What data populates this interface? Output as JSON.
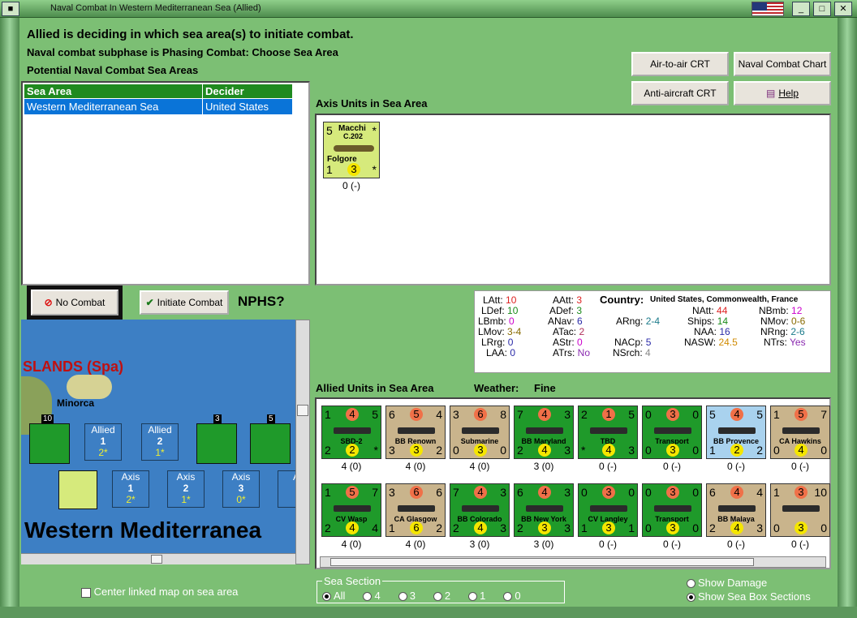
{
  "window": {
    "title": "Naval Combat In Western Mediterranean Sea (Allied)"
  },
  "status": {
    "line1": "Allied is deciding in which sea area(s) to initiate combat.",
    "line2": "Naval combat subphase is Phasing Combat: Choose Sea Area",
    "line3": "Potential Naval Combat Sea Areas"
  },
  "sea_table": {
    "headers": [
      "Sea Area",
      "Decider"
    ],
    "rows": [
      [
        "Western Mediterranean Sea",
        "United States"
      ]
    ]
  },
  "buttons": {
    "air_to_air": "Air-to-air CRT",
    "naval_chart": "Naval Combat Chart",
    "anti_aircraft": "Anti-aircraft CRT",
    "help": "Help",
    "no_combat": "No Combat",
    "initiate": "Initiate Combat"
  },
  "nphs": "NPHS?",
  "axis_units": {
    "label": "Axis Units in Sea Area",
    "counter": {
      "name_top": "Macchi",
      "name_mid": "C.202",
      "name_bottom": "Folgore",
      "tl": "5",
      "tr": "*",
      "bl": "1",
      "bc": "3",
      "br": "*",
      "under": "0 (-)"
    }
  },
  "stats": {
    "LAtt": "10",
    "LDef": "10",
    "LBmb": "0",
    "LMov": "3-4",
    "LRrg": "0",
    "LAA": "0",
    "AAtt": "3",
    "ADef": "3",
    "ANav": "6",
    "ATac": "2",
    "AStr": "0",
    "ATrs": "No",
    "country_label": "Country:",
    "country": "United States, Commonwealth, France",
    "ARng": "2-4",
    "NACp": "5",
    "NSrch": "4",
    "NAtt": "44",
    "Ships": "14",
    "NAA": "16",
    "NASW": "24.5",
    "NBmb": "12",
    "NMov": "0-6",
    "NRng": "2-6",
    "NTrs": "Yes"
  },
  "allied_units": {
    "label": "Allied Units in Sea Area",
    "weather_label": "Weather:",
    "weather": "Fine",
    "row1": [
      {
        "name": "SBD-2",
        "tl": "1",
        "tc": "4",
        "tr": "5",
        "bl": "2",
        "bc": "2",
        "br": "*",
        "under": "4 (0)",
        "color": "#1f9a2a"
      },
      {
        "name": "BB Renown",
        "tl": "6",
        "tc": "5",
        "tr": "4",
        "bl": "3",
        "bc": "3",
        "br": "2",
        "under": "4 (0)",
        "color": "#c9b48c"
      },
      {
        "name": "Submarine",
        "tl": "3",
        "tc": "6",
        "tr": "8",
        "bl": "0",
        "bc": "3",
        "br": "0",
        "under": "4 (0)",
        "color": "#c9b48c"
      },
      {
        "name": "BB Maryland",
        "tl": "7",
        "tc": "4",
        "tr": "3",
        "bl": "2",
        "bc": "4",
        "br": "3",
        "under": "3 (0)",
        "color": "#1f9a2a"
      },
      {
        "name": "TBD",
        "tl": "2",
        "tc": "1",
        "tr": "5",
        "bl": "*",
        "bc": "4",
        "br": "3",
        "under": "0 (-)",
        "color": "#1f9a2a"
      },
      {
        "name": "Transport",
        "tl": "0",
        "tc": "3",
        "tr": "0",
        "bl": "0",
        "bc": "3",
        "br": "0",
        "under": "0 (-)",
        "color": "#1f9a2a"
      },
      {
        "name": "BB Provence",
        "tl": "5",
        "tc": "4",
        "tr": "5",
        "bl": "1",
        "bc": "2",
        "br": "2",
        "under": "0 (-)",
        "color": "#a9d2ee"
      },
      {
        "name": "CA Hawkins",
        "tl": "1",
        "tc": "5",
        "tr": "7",
        "bl": "0",
        "bc": "4",
        "br": "0",
        "under": "0 (-)",
        "color": "#c9b48c"
      }
    ],
    "row2": [
      {
        "name": "CV Wasp",
        "tl": "1",
        "tc": "5",
        "tr": "7",
        "bl": "2",
        "bc": "4",
        "br": "4",
        "under": "4 (0)",
        "color": "#1f9a2a"
      },
      {
        "name": "CA Glasgow",
        "tl": "3",
        "tc": "6",
        "tr": "6",
        "bl": "1",
        "bc": "6",
        "br": "2",
        "under": "4 (0)",
        "color": "#c9b48c"
      },
      {
        "name": "BB Colorado",
        "tl": "7",
        "tc": "4",
        "tr": "3",
        "bl": "2",
        "bc": "4",
        "br": "3",
        "under": "3 (0)",
        "color": "#1f9a2a"
      },
      {
        "name": "BB New York",
        "tl": "6",
        "tc": "4",
        "tr": "3",
        "bl": "2",
        "bc": "3",
        "br": "3",
        "under": "3 (0)",
        "color": "#1f9a2a"
      },
      {
        "name": "CV Langley",
        "tl": "0",
        "tc": "3",
        "tr": "0",
        "bl": "1",
        "bc": "3",
        "br": "1",
        "under": "0 (-)",
        "color": "#1f9a2a"
      },
      {
        "name": "Transport",
        "tl": "0",
        "tc": "3",
        "tr": "0",
        "bl": "0",
        "bc": "3",
        "br": "0",
        "under": "0 (-)",
        "color": "#1f9a2a"
      },
      {
        "name": "BB Malaya",
        "tl": "6",
        "tc": "4",
        "tr": "4",
        "bl": "2",
        "bc": "4",
        "br": "3",
        "under": "0 (-)",
        "color": "#c9b48c"
      },
      {
        "name": "",
        "tl": "1",
        "tc": "3",
        "tr": "10",
        "bl": "0",
        "bc": "3",
        "br": "0",
        "under": "0 (-)",
        "color": "#c9b48c"
      }
    ]
  },
  "map": {
    "islands": "SLANDS (Spa)",
    "minorca": "Minorca",
    "sea_name": "Western Mediterranea",
    "allied_boxes": [
      {
        "side": "Allied",
        "num": "1",
        "val": "2*"
      },
      {
        "side": "Allied",
        "num": "2",
        "val": "1*"
      }
    ],
    "axis_boxes": [
      {
        "side": "Axis",
        "num": "1",
        "val": "2*"
      },
      {
        "side": "Axis",
        "num": "2",
        "val": "1*"
      },
      {
        "side": "Axis",
        "num": "3",
        "val": "0*"
      },
      {
        "side": "A",
        "num": "",
        "val": ""
      }
    ],
    "stack_labels": [
      "10",
      "3",
      "5"
    ]
  },
  "center_map": "Center linked map on sea area",
  "sea_section": {
    "label": "Sea Section",
    "options": [
      "All",
      "4",
      "3",
      "2",
      "1",
      "0"
    ],
    "selected": "All"
  },
  "show_damage": "Show Damage",
  "show_sections": "Show Sea Box Sections"
}
